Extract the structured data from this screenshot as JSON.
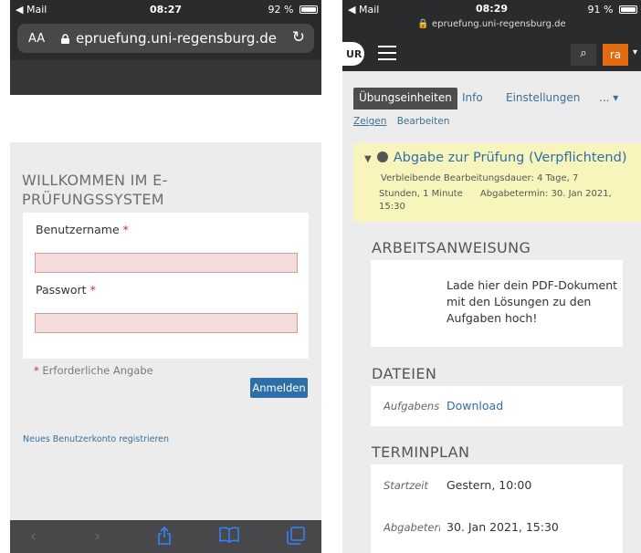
{
  "left": {
    "status": {
      "back": "◀ Mail",
      "time": "08:27",
      "battery": "92 %"
    },
    "url_bar": {
      "aa": "AA",
      "url": "epruefung.uni-regensburg.de"
    },
    "login": {
      "heading_line1": "WILLKOMMEN IM E-",
      "heading_line2": "PRÜFUNGSSYSTEM",
      "username_label": "Benutzername",
      "password_label": "Passwort",
      "required_star": "*",
      "required_note": "Erforderliche Angabe",
      "login_button": "Anmelden",
      "register_link": "Neues Benutzerkonto registrieren"
    },
    "toolbar": [
      "back-icon",
      "forward-icon",
      "share-icon",
      "bookmarks-icon",
      "tabs-icon"
    ]
  },
  "right": {
    "status": {
      "back": "◀ Mail",
      "time": "08:29",
      "battery": "91 %",
      "url": "epruefung.uni-regensburg.de"
    },
    "nav": {
      "logo": "UR",
      "user": "ra"
    },
    "tabs": [
      "Übungseinheiten",
      "Info",
      "Einstellungen",
      "... ▾"
    ],
    "subtabs": [
      "Zeigen",
      "Bearbeiten"
    ],
    "exam": {
      "title": "Abgabe zur Prüfung (Verpflichtend)",
      "meta_line1": "Verbleibende Bearbeitungsdauer: 4 Tage, 7",
      "meta_line2": "Stunden, 1 Minute      Abgabetermin: 30. Jan 2021,",
      "meta_line3": "15:30"
    },
    "sections": {
      "instruction_title": "ARBEITSANWEISUNG",
      "instruction_text": "Lade hier dein PDF-Dokument mit den Lösungen zu den Aufgaben hoch!",
      "files_title": "DATEIEN",
      "files_label": "Aufgabenstellung",
      "files_link": "Download",
      "schedule_title": "TERMINPLAN",
      "start_label": "Startzeit",
      "start_value": "Gestern, 10:00",
      "due_label": "Abgabetermin",
      "due_value": "30. Jan 2021, 15:30"
    }
  },
  "colors": {
    "accent": "#2f6fa8",
    "user_badge": "#e26b12",
    "highlight": "#f8f5bc",
    "dark_bar": "#2b2b2d"
  }
}
